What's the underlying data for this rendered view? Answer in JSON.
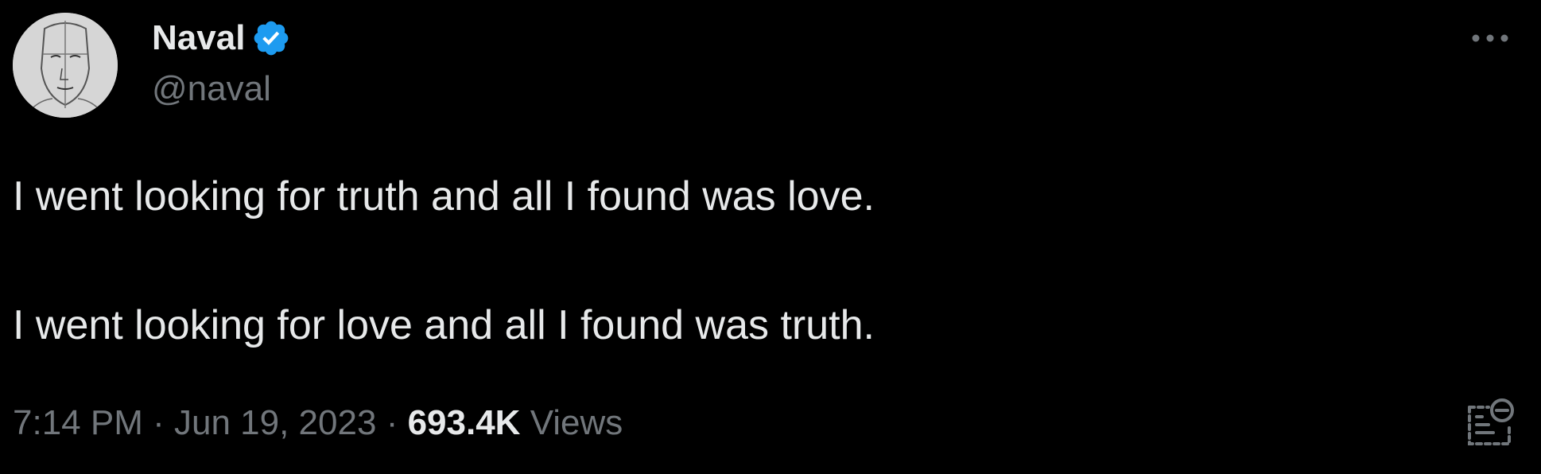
{
  "author": {
    "display_name": "Naval",
    "handle": "@naval",
    "verified": true,
    "verified_color": "#1d9bf0"
  },
  "tweet": {
    "lines": [
      "I went looking for truth and all I found was love.",
      "I went looking for love and all I found was truth."
    ]
  },
  "meta": {
    "time": "7:14 PM",
    "separator": "·",
    "date": "Jun 19, 2023",
    "views_count": "693.4K",
    "views_label": "Views"
  },
  "icons": {
    "more": "more-options-icon",
    "analytics": "analytics-icon",
    "verified": "verified-badge-icon"
  },
  "colors": {
    "background": "#000000",
    "primary_text": "#e7e9ea",
    "secondary_text": "#71767b",
    "accent": "#1d9bf0"
  }
}
